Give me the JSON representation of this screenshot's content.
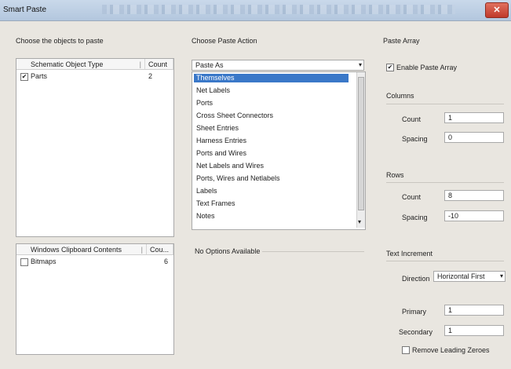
{
  "window": {
    "title": "Smart Paste",
    "close_glyph": "✕"
  },
  "objects": {
    "section_label": "Choose the objects to paste",
    "col_type": "Schematic Object Type",
    "col_count": "Count",
    "rows": [
      {
        "checked": true,
        "type": "Parts",
        "count": "2"
      }
    ]
  },
  "clipboard": {
    "col_contents": "Windows Clipboard Contents",
    "col_count": "Cou...",
    "rows": [
      {
        "checked": false,
        "type": "Bitmaps",
        "count": "6"
      }
    ]
  },
  "paste_action": {
    "section_label": "Choose Paste Action",
    "selected": "Paste As",
    "options": [
      "Themselves",
      "Net Labels",
      "Ports",
      "Cross Sheet Connectors",
      "Sheet Entries",
      "Harness Entries",
      "Ports and Wires",
      "Net Labels and Wires",
      "Ports, Wires and Netlabels",
      "Labels",
      "Text Frames",
      "Notes"
    ],
    "highlighted_index": 0,
    "options_note": "No Options Available"
  },
  "paste_array": {
    "section_label": "Paste Array",
    "enable_label": "Enable Paste Array",
    "enabled": true,
    "columns_label": "Columns",
    "col_count_label": "Count",
    "col_count_value": "1",
    "col_spacing_label": "Spacing",
    "col_spacing_value": "0",
    "rows_label": "Rows",
    "row_count_label": "Count",
    "row_count_value": "8",
    "row_spacing_label": "Spacing",
    "row_spacing_value": "-10",
    "text_increment_label": "Text Increment",
    "direction_label": "Direction",
    "direction_value": "Horizontal First",
    "primary_label": "Primary",
    "primary_value": "1",
    "secondary_label": "Secondary",
    "secondary_value": "1",
    "remove_zeros_label": "Remove Leading Zeroes",
    "remove_zeros": false
  }
}
